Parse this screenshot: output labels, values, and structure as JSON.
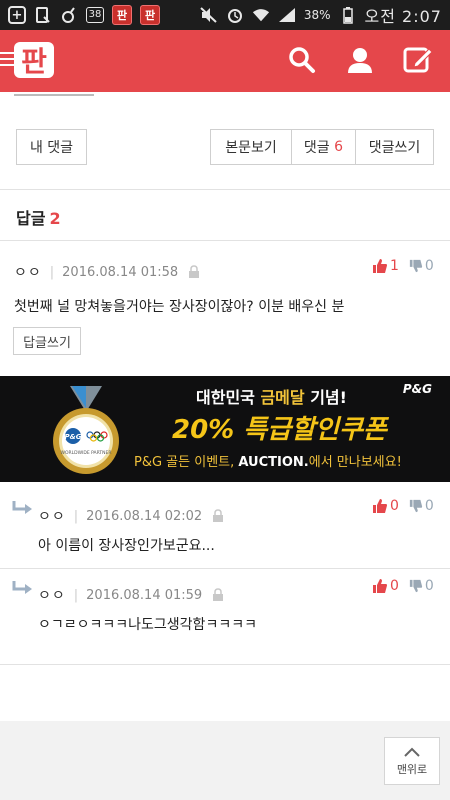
{
  "status_bar": {
    "notif_count": "38",
    "battery": "38%",
    "time": "오전 2:07"
  },
  "app": {
    "logo_text": "판",
    "accent_color": "#e5474b"
  },
  "header_icons": [
    "search-icon",
    "user-icon",
    "write-icon"
  ],
  "tabs": {
    "my_comments": "내 댓글",
    "view_post": "본문보기",
    "comments_label": "댓글",
    "comments_count": "6",
    "write_comment": "댓글쓰기"
  },
  "replies": {
    "title": "답글",
    "count": "2"
  },
  "comments": [
    {
      "author": "ㅇㅇ",
      "date": "2016.08.14 01:58",
      "text": "첫번째 널 망쳐놓을거야는 장사장이잖아? 이분 배우신 분",
      "up": "1",
      "down": "0",
      "reply_button": "답글쓰기"
    },
    {
      "author": "ㅇㅇ",
      "date": "2016.08.14 02:02",
      "text": "아 이름이 장사장인가보군요...",
      "up": "0",
      "down": "0"
    },
    {
      "author": "ㅇㅇ",
      "date": "2016.08.14 01:59",
      "text": "ㅇㄱㄹㅇㅋㅋㅋ나도그생각함ㅋㅋㅋㅋ",
      "up": "0",
      "down": "0"
    }
  ],
  "banner": {
    "brand": "P&G",
    "line1_pre": "대한민국 ",
    "line1_gold": "금메달",
    "line1_post": " 기념!",
    "line2": "20% 특급할인쿠폰",
    "line3_pre": "P&G 골든 이벤트, ",
    "line3_brand": "AUCTION.",
    "line3_post": "에서 만나보세요!",
    "medal_logo": "P&G",
    "medal_caption": "WORLDWIDE PARTNER"
  },
  "footer": {
    "to_top": "맨위로"
  }
}
